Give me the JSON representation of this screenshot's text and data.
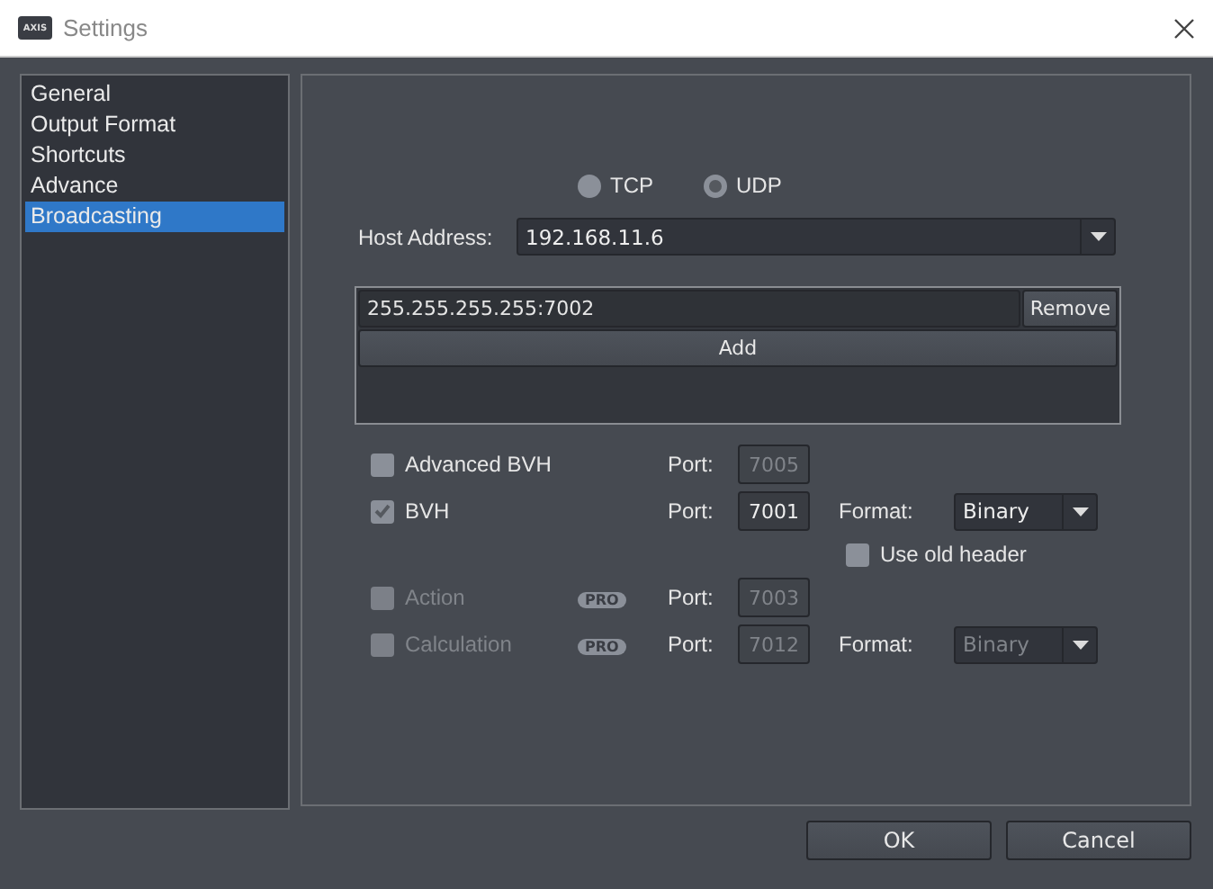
{
  "window": {
    "title": "Settings",
    "logo": "AXIS"
  },
  "sidebar": {
    "items": [
      {
        "label": "General",
        "selected": false
      },
      {
        "label": "Output Format",
        "selected": false
      },
      {
        "label": "Shortcuts",
        "selected": false
      },
      {
        "label": "Advance",
        "selected": false
      },
      {
        "label": "Broadcasting",
        "selected": true
      }
    ]
  },
  "protocol": [
    {
      "label": "TCP",
      "selected": false
    },
    {
      "label": "UDP",
      "selected": true
    }
  ],
  "host": {
    "label": "Host Address:",
    "value": "192.168.11.6"
  },
  "targets": {
    "items": [
      {
        "address": "255.255.255.255:7002",
        "action": "Remove"
      }
    ],
    "add": "Add"
  },
  "outputs": [
    {
      "kind": "output",
      "name": "Advanced BVH",
      "checked": false,
      "disabled": false,
      "port_label": "Port:",
      "port": "7005"
    },
    {
      "kind": "output",
      "name": "BVH",
      "checked": true,
      "disabled": false,
      "port_label": "Port:",
      "port": "7001",
      "format_label": "Format:",
      "format": "Binary"
    },
    {
      "kind": "option",
      "name": "Use old header",
      "checked": false,
      "disabled": false
    },
    {
      "kind": "output",
      "name": "Action",
      "checked": false,
      "disabled": true,
      "badge": "PRO",
      "port_label": "Port:",
      "port": "7003"
    },
    {
      "kind": "output",
      "name": "Calculation",
      "checked": false,
      "disabled": true,
      "badge": "PRO",
      "port_label": "Port:",
      "port": "7012",
      "format_label": "Format:",
      "format": "Binary"
    }
  ],
  "buttons": [
    "OK",
    "Cancel"
  ]
}
